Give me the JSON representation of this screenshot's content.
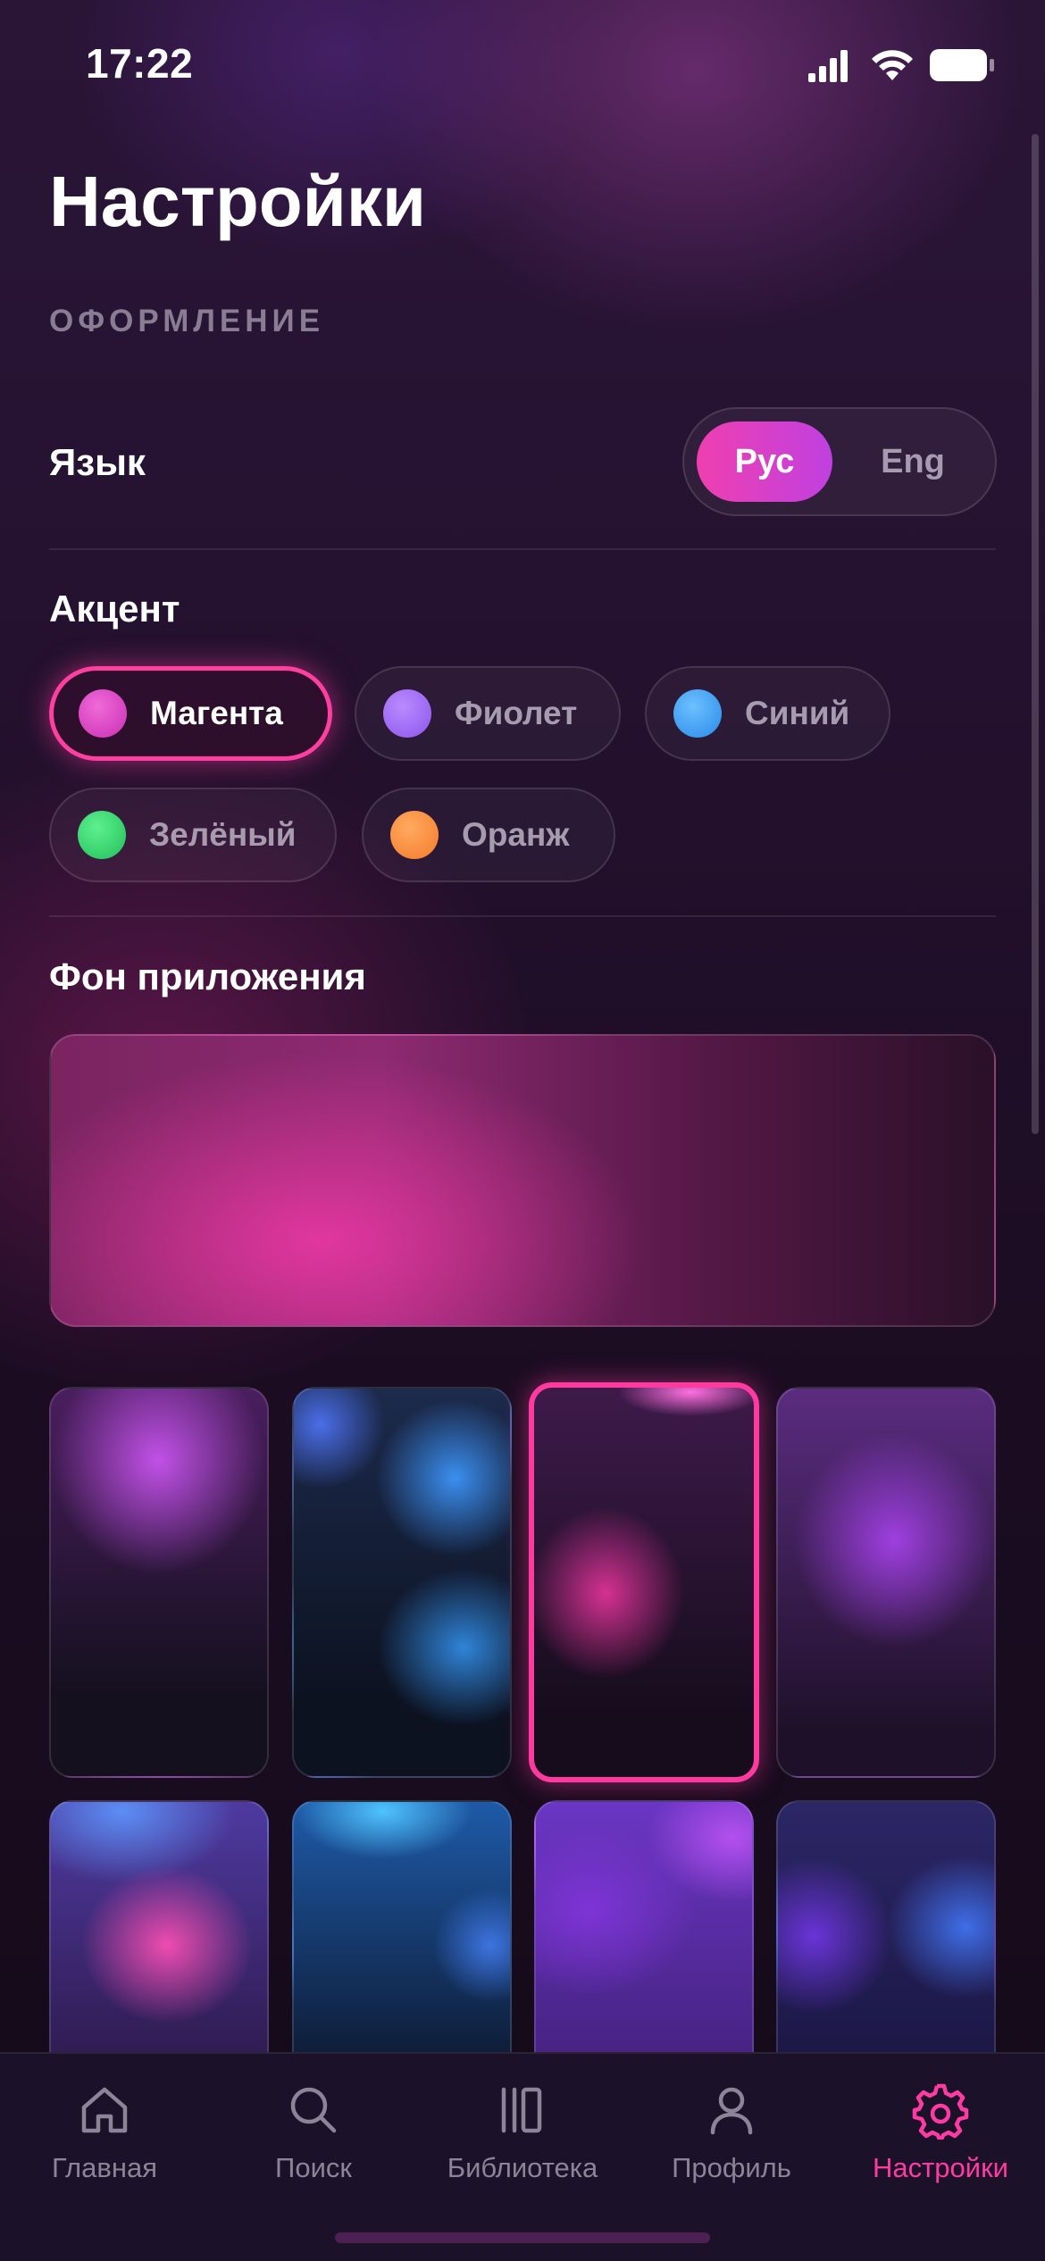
{
  "status_bar": {
    "time": "17:22",
    "icons": [
      "signal-icon",
      "wifi-icon",
      "battery-icon"
    ]
  },
  "page": {
    "title": "Настройки"
  },
  "appearance": {
    "section_label": "ОФОРМЛЕНИЕ",
    "language": {
      "label": "Язык",
      "options": [
        "Рус",
        "Eng"
      ],
      "selected": "Рус"
    },
    "accent": {
      "label": "Акцент",
      "selected": "Магента",
      "options": [
        {
          "label": "Магента",
          "color": "#e03cc0"
        },
        {
          "label": "Фиолет",
          "color": "#a268f4"
        },
        {
          "label": "Синий",
          "color": "#3fa3f5"
        },
        {
          "label": "Зелёный",
          "color": "#2fd56a"
        },
        {
          "label": "Оранж",
          "color": "#ff8a3a"
        }
      ]
    },
    "background": {
      "label": "Фон приложения",
      "selected_index": 2,
      "swatch_count_visible": 8
    }
  },
  "tab_bar": {
    "active": "Настройки",
    "tabs": [
      {
        "label": "Главная",
        "icon": "home-icon"
      },
      {
        "label": "Поиск",
        "icon": "search-icon"
      },
      {
        "label": "Библиотека",
        "icon": "library-icon"
      },
      {
        "label": "Профиль",
        "icon": "profile-icon"
      },
      {
        "label": "Настройки",
        "icon": "gear-icon"
      }
    ]
  },
  "colors": {
    "accent": "#ff3aa3",
    "inactive_text": "#8d8497"
  }
}
